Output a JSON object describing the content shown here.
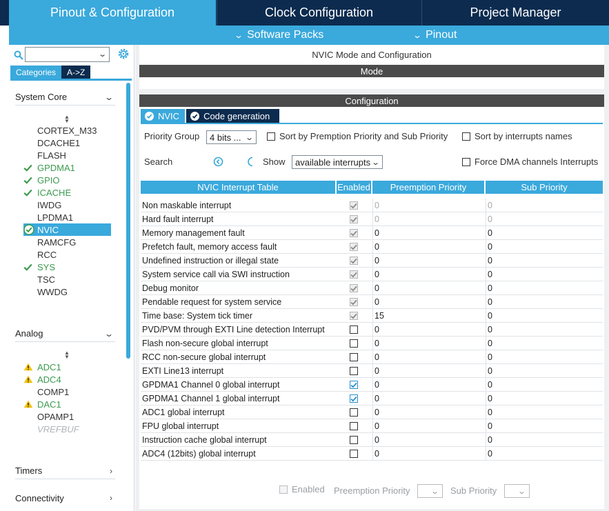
{
  "top_tabs": [
    {
      "label": "Pinout & Configuration",
      "active": true
    },
    {
      "label": "Clock Configuration",
      "active": false
    },
    {
      "label": "Project Manager",
      "active": false
    }
  ],
  "sub_menu": [
    {
      "label": "Software Packs"
    },
    {
      "label": "Pinout"
    }
  ],
  "left_panel": {
    "search": {
      "value": "",
      "icon": "search-icon"
    },
    "settings_icon": "gear-icon",
    "tabs": [
      {
        "label": "Categories",
        "active": true
      },
      {
        "label": "A->Z",
        "active": false
      }
    ],
    "groups": {
      "system_core": {
        "label": "System Core",
        "items": [
          {
            "label": "CORTEX_M33",
            "status": "none"
          },
          {
            "label": "DCACHE1",
            "status": "none"
          },
          {
            "label": "FLASH",
            "status": "none"
          },
          {
            "label": "GPDMA1",
            "status": "ok"
          },
          {
            "label": "GPIO",
            "status": "ok"
          },
          {
            "label": "ICACHE",
            "status": "ok"
          },
          {
            "label": "IWDG",
            "status": "none"
          },
          {
            "label": "LPDMA1",
            "status": "none"
          },
          {
            "label": "NVIC",
            "status": "selected"
          },
          {
            "label": "RAMCFG",
            "status": "none"
          },
          {
            "label": "RCC",
            "status": "none"
          },
          {
            "label": "SYS",
            "status": "ok"
          },
          {
            "label": "TSC",
            "status": "none"
          },
          {
            "label": "WWDG",
            "status": "none"
          }
        ]
      },
      "analog": {
        "label": "Analog",
        "items": [
          {
            "label": "ADC1",
            "status": "warning"
          },
          {
            "label": "ADC4",
            "status": "warning"
          },
          {
            "label": "COMP1",
            "status": "none"
          },
          {
            "label": "DAC1",
            "status": "warning"
          },
          {
            "label": "OPAMP1",
            "status": "none"
          },
          {
            "label": "VREFBUF",
            "status": "disabled"
          }
        ]
      },
      "timers": {
        "label": "Timers"
      },
      "connectivity": {
        "label": "Connectivity"
      }
    }
  },
  "main": {
    "title": "NVIC Mode and Configuration",
    "mode_label": "Mode",
    "config_label": "Configuration",
    "subtabs": [
      {
        "label": "NVIC",
        "active": true
      },
      {
        "label": "Code generation",
        "active": false
      }
    ],
    "priority_group": {
      "label": "Priority Group",
      "value": "4 bits ..."
    },
    "sort_premption": {
      "label": "Sort by Premption Priority and Sub Priority",
      "checked": false
    },
    "sort_names": {
      "label": "Sort by interrupts names",
      "checked": false
    },
    "search_label": "Search",
    "show": {
      "label": "Show",
      "value": "available interrupts"
    },
    "force_dma": {
      "label": "Force DMA channels Interrupts",
      "checked": false
    },
    "table": {
      "headers": [
        "NVIC Interrupt Table",
        "Enabled",
        "Preemption Priority",
        "Sub Priority"
      ],
      "rows": [
        {
          "name": "Non maskable interrupt",
          "enabled": true,
          "locked": true,
          "preempt": "0",
          "sub": "0",
          "greyed": true
        },
        {
          "name": "Hard fault interrupt",
          "enabled": true,
          "locked": true,
          "preempt": "0",
          "sub": "0",
          "greyed": true
        },
        {
          "name": "Memory management fault",
          "enabled": true,
          "locked": true,
          "preempt": "0",
          "sub": "0",
          "greyed": false
        },
        {
          "name": "Prefetch fault, memory access fault",
          "enabled": true,
          "locked": true,
          "preempt": "0",
          "sub": "0",
          "greyed": false
        },
        {
          "name": "Undefined instruction or illegal state",
          "enabled": true,
          "locked": true,
          "preempt": "0",
          "sub": "0",
          "greyed": false
        },
        {
          "name": "System service call via SWI instruction",
          "enabled": true,
          "locked": true,
          "preempt": "0",
          "sub": "0",
          "greyed": false
        },
        {
          "name": "Debug monitor",
          "enabled": true,
          "locked": true,
          "preempt": "0",
          "sub": "0",
          "greyed": false
        },
        {
          "name": "Pendable request for system service",
          "enabled": true,
          "locked": true,
          "preempt": "0",
          "sub": "0",
          "greyed": false
        },
        {
          "name": "Time base: System tick timer",
          "enabled": true,
          "locked": true,
          "preempt": "15",
          "sub": "0",
          "greyed": false
        },
        {
          "name": "PVD/PVM through EXTI Line detection Interrupt",
          "enabled": false,
          "locked": false,
          "preempt": "0",
          "sub": "0",
          "greyed": false
        },
        {
          "name": "Flash non-secure global interrupt",
          "enabled": false,
          "locked": false,
          "preempt": "0",
          "sub": "0",
          "greyed": false
        },
        {
          "name": "RCC non-secure global interrupt",
          "enabled": false,
          "locked": false,
          "preempt": "0",
          "sub": "0",
          "greyed": false
        },
        {
          "name": "EXTI Line13 interrupt",
          "enabled": false,
          "locked": false,
          "preempt": "0",
          "sub": "0",
          "greyed": false
        },
        {
          "name": "GPDMA1 Channel 0 global interrupt",
          "enabled": true,
          "locked": false,
          "preempt": "0",
          "sub": "0",
          "greyed": false
        },
        {
          "name": "GPDMA1 Channel 1 global interrupt",
          "enabled": true,
          "locked": false,
          "preempt": "0",
          "sub": "0",
          "greyed": false
        },
        {
          "name": "ADC1 global interrupt",
          "enabled": false,
          "locked": false,
          "preempt": "0",
          "sub": "0",
          "greyed": false
        },
        {
          "name": "FPU global interrupt",
          "enabled": false,
          "locked": false,
          "preempt": "0",
          "sub": "0",
          "greyed": false
        },
        {
          "name": "Instruction cache global interrupt",
          "enabled": false,
          "locked": false,
          "preempt": "0",
          "sub": "0",
          "greyed": false
        },
        {
          "name": "ADC4 (12bits) global interrupt",
          "enabled": false,
          "locked": false,
          "preempt": "0",
          "sub": "0",
          "greyed": false
        }
      ]
    },
    "bottom": {
      "enabled_label": "Enabled",
      "preempt_label": "Preemption Priority",
      "sub_label": "Sub Priority"
    }
  },
  "colors": {
    "accent_blue": "#3aa9dc",
    "navy": "#0c2b4f",
    "ok_green": "#3c9a4f",
    "warning_yellow": "#f2c200",
    "header_dark": "#4b4b4b"
  }
}
